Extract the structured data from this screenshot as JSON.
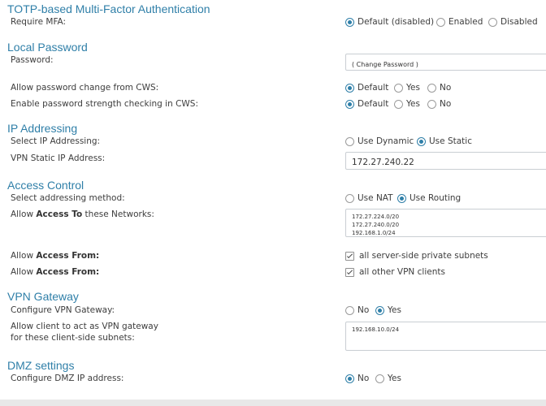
{
  "mfa": {
    "title": "TOTP-based Multi-Factor Authentication",
    "require_label": "Require MFA:",
    "options": [
      "Default (disabled)",
      "Enabled",
      "Disabled"
    ],
    "selected": 0
  },
  "local_password": {
    "title": "Local Password",
    "password_label": "Password:",
    "change_password": "( Change Password )",
    "allow_change_label": "Allow password change from CWS:",
    "allow_change_options": [
      "Default",
      "Yes",
      "No"
    ],
    "allow_change_selected": 0,
    "strength_label": "Enable password strength checking in CWS:",
    "strength_options": [
      "Default",
      "Yes",
      "No"
    ],
    "strength_selected": 0
  },
  "ip_addressing": {
    "title": "IP Addressing",
    "select_label": "Select IP Addressing:",
    "options": [
      "Use Dynamic",
      "Use Static"
    ],
    "selected": 1,
    "static_ip_label": "VPN Static IP Address:",
    "static_ip_value": "172.27.240.22"
  },
  "access_control": {
    "title": "Access Control",
    "method_label": "Select addressing method:",
    "method_options": [
      "Use NAT",
      "Use Routing"
    ],
    "method_selected": 1,
    "networks_label_pre": "Allow ",
    "networks_label_bold": "Access To",
    "networks_label_post": " these Networks:",
    "networks": [
      "172.27.224.0/20",
      "172.27.240.0/20",
      "192.168.1.0/24"
    ],
    "access_from_pre": "Allow ",
    "access_from_bold": "Access From:",
    "access_from_1": "all server-side private subnets",
    "access_from_2": "all other VPN clients"
  },
  "vpn_gateway": {
    "title": "VPN Gateway",
    "configure_label": "Configure VPN Gateway:",
    "options": [
      "No",
      "Yes"
    ],
    "selected": 1,
    "client_gateway_label_1": "Allow client to act as VPN gateway",
    "client_gateway_label_2": "for these client-side subnets:",
    "client_subnets": [
      "192.168.10.0/24"
    ]
  },
  "dmz": {
    "title": "DMZ settings",
    "configure_label": "Configure DMZ IP address:",
    "options": [
      "No",
      "Yes"
    ],
    "selected": 0
  },
  "colors": {
    "accent": "#2f7fa8",
    "text": "#3d3d3d",
    "border": "#c9ced3"
  }
}
